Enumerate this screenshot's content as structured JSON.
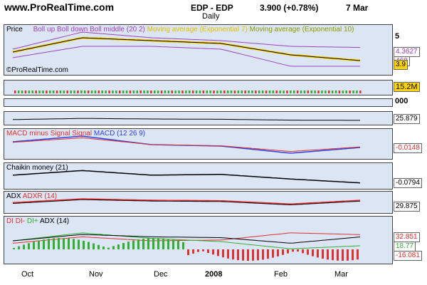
{
  "header": {
    "site": "www.ProRealTime.com",
    "instrument": "EDP - EDP",
    "price": "3.900 (+0.78%)",
    "date": "7 Mar",
    "period": "Daily"
  },
  "panels": {
    "price": {
      "title": "Price",
      "legend": [
        "Boll up",
        "Boll down",
        "Boll middle (20 2)"
      ],
      "legend2": "Moving average (Exponential 7)",
      "legend3": "Moving average (Exponential 10)",
      "watermark": "©ProRealTime.com",
      "y_top": "5",
      "v1": "4.3627",
      "v2": "468",
      "v3": "3.9"
    },
    "volume": {
      "value": "15.2M"
    },
    "thin": {
      "value": "000"
    },
    "stoch": {
      "value": "25.879"
    },
    "macd": {
      "title1": "MACD minus Signal",
      "title2": "Signal",
      "title3": "MACD (12 26 9)",
      "value": "-0.0148"
    },
    "chaikin": {
      "title": "Chaikin money (21)",
      "value": "-0.0794"
    },
    "adx": {
      "title1": "ADX",
      "title2": "ADXR (14)",
      "value": "29.875"
    },
    "di": {
      "t1": "DI",
      "t2": "DI-",
      "t3": "DI+",
      "t4": "ADX (14)",
      "v1": "32.851",
      "v2": "18.77",
      "v3": "-16.081"
    }
  },
  "x_axis": {
    "labels": [
      "Oct",
      "Nov",
      "Dec",
      "2008",
      "Feb",
      "Mar"
    ]
  },
  "colors": {
    "panel_bg": "#dbe5f4",
    "boll": "#a040c0",
    "ema7": "#ffd400",
    "ema10": "#c8d800",
    "macd": "#3040e0",
    "signal": "#e03030",
    "green": "#30b030",
    "red": "#e03030"
  },
  "chart_data": {
    "type": "line",
    "title": "EDP - EDP",
    "x": [
      "Oct",
      "Nov",
      "Dec",
      "2008",
      "Feb",
      "Mar"
    ],
    "series": [
      {
        "name": "Price",
        "values": [
          4.2,
          4.7,
          4.6,
          4.5,
          4.1,
          3.9
        ]
      },
      {
        "name": "Boll up",
        "values": [
          4.3,
          4.9,
          4.7,
          4.6,
          4.4,
          4.36
        ]
      },
      {
        "name": "Boll down",
        "values": [
          4.0,
          4.4,
          4.4,
          4.3,
          3.7,
          3.7
        ]
      },
      {
        "name": "MACD",
        "values": [
          0.02,
          0.06,
          0.0,
          -0.01,
          -0.06,
          -0.02
        ]
      },
      {
        "name": "Chaikin money",
        "values": [
          0.02,
          0.08,
          0.02,
          0.03,
          -0.03,
          -0.08
        ]
      },
      {
        "name": "ADX",
        "values": [
          25,
          33,
          30,
          29,
          22,
          29.9
        ]
      }
    ],
    "ylim": [
      3.5,
      5
    ]
  }
}
